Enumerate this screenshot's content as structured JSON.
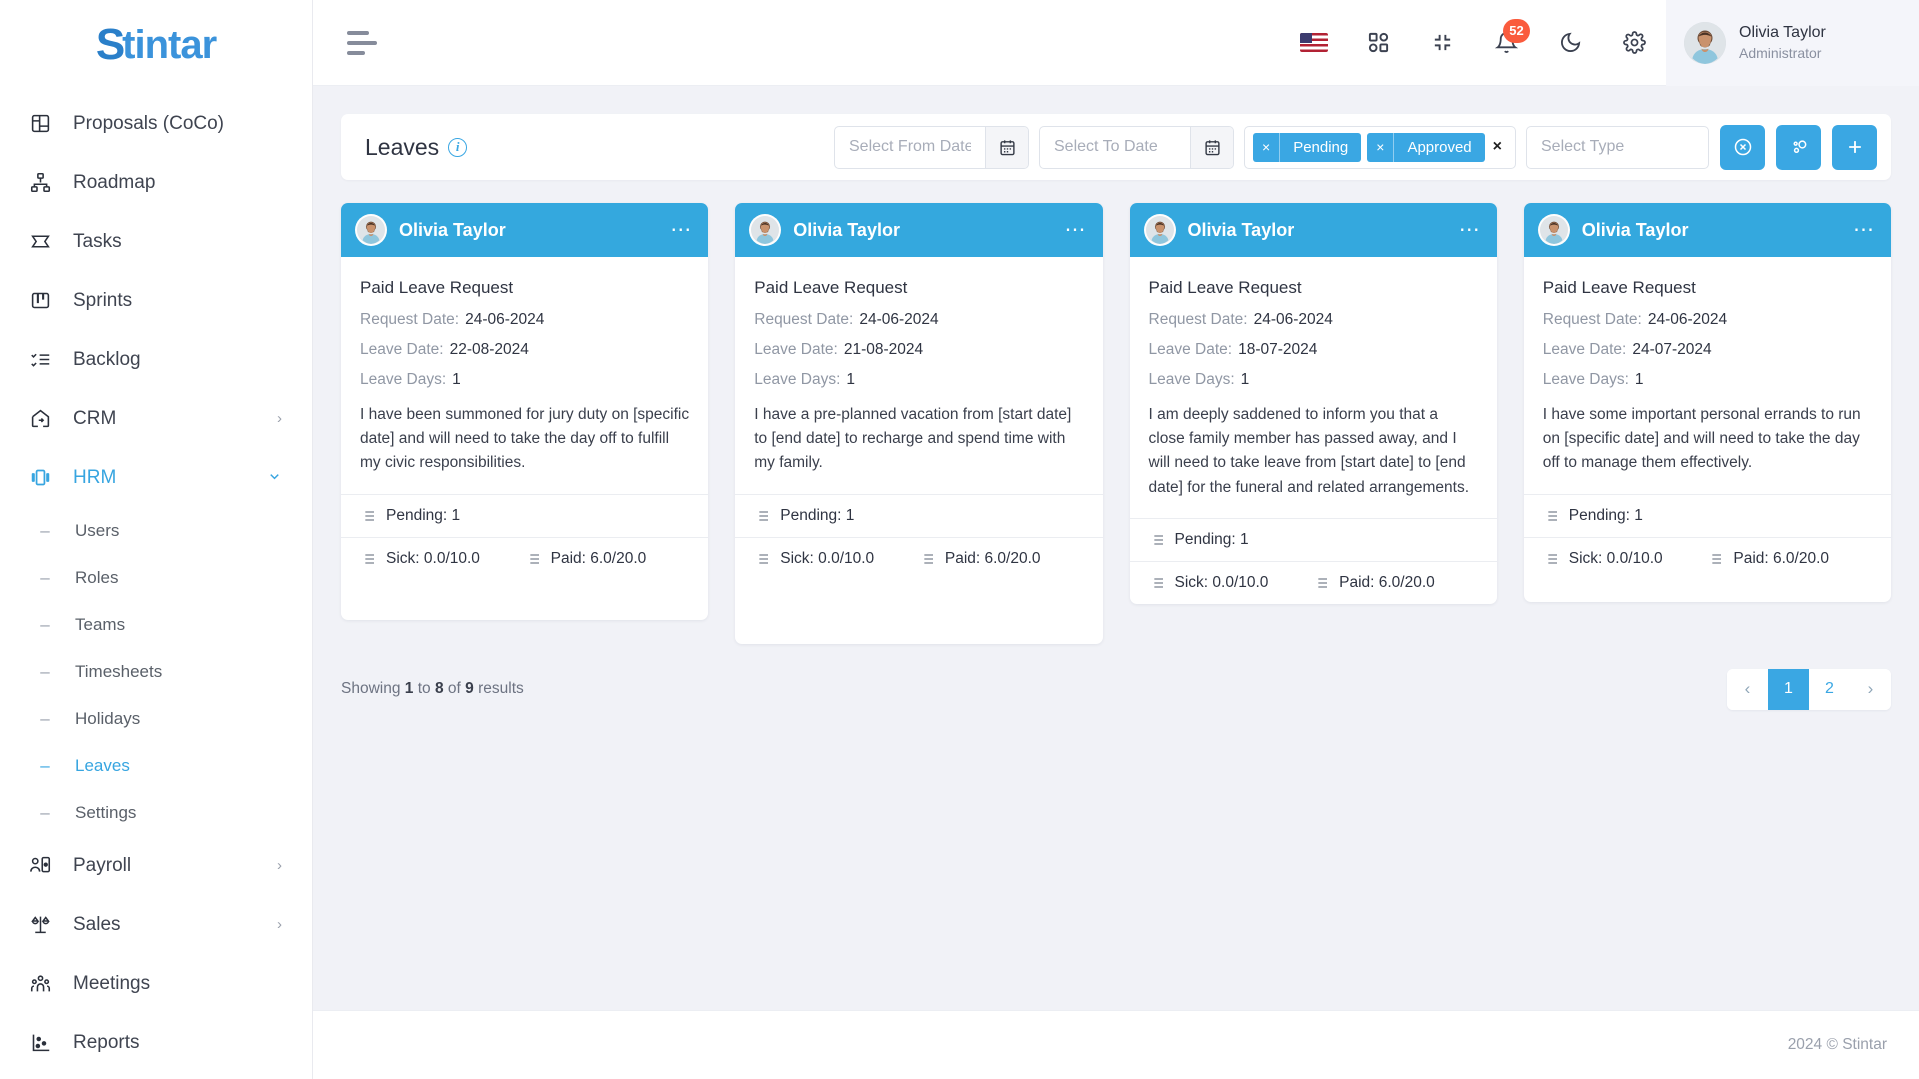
{
  "brand": {
    "first": "S",
    "rest": "tintar"
  },
  "sidebar": {
    "items": [
      {
        "label": "Proposals (CoCo)",
        "icon": "proposals-icon",
        "chevron": ""
      },
      {
        "label": "Roadmap",
        "icon": "roadmap-icon",
        "chevron": ""
      },
      {
        "label": "Tasks",
        "icon": "tasks-icon",
        "chevron": ""
      },
      {
        "label": "Sprints",
        "icon": "sprints-icon",
        "chevron": ""
      },
      {
        "label": "Backlog",
        "icon": "backlog-icon",
        "chevron": ""
      },
      {
        "label": "CRM",
        "icon": "crm-icon",
        "chevron": "›"
      },
      {
        "label": "HRM",
        "icon": "hrm-icon",
        "chevron": "⌄"
      }
    ],
    "hrm_children": [
      {
        "label": "Users"
      },
      {
        "label": "Roles"
      },
      {
        "label": "Teams"
      },
      {
        "label": "Timesheets"
      },
      {
        "label": "Holidays"
      },
      {
        "label": "Leaves"
      },
      {
        "label": "Settings"
      }
    ],
    "tail_items": [
      {
        "label": "Payroll",
        "icon": "payroll-icon",
        "chevron": "›"
      },
      {
        "label": "Sales",
        "icon": "sales-icon",
        "chevron": "›"
      },
      {
        "label": "Meetings",
        "icon": "meetings-icon",
        "chevron": ""
      },
      {
        "label": "Reports",
        "icon": "reports-icon",
        "chevron": ""
      }
    ]
  },
  "topbar": {
    "menu_toggle": "hamburger-icon",
    "language_flag": "us-flag-icon",
    "apps": "grid-apps-icon",
    "fullscreen": "collapse-fullscreen-icon",
    "notifications_icon": "bell-icon",
    "notifications_count": "52",
    "theme": "moon-dark-mode-icon",
    "settings": "gear-icon",
    "user_name": "Olivia Taylor",
    "user_role": "Administrator"
  },
  "filters": {
    "title": "Leaves",
    "info": "i",
    "from_date_placeholder": "Select From Date",
    "from_date_value": "",
    "to_date_placeholder": "Select To Date",
    "to_date_value": "",
    "status_tags": [
      "Pending",
      "Approved"
    ],
    "tag_remove": "×",
    "clear_all": "×",
    "type_placeholder": "Select Type",
    "buttons": [
      {
        "name": "reset-filters-button",
        "icon": "circle-x-icon"
      },
      {
        "name": "advanced-filter-button",
        "icon": "filter-nodes-icon"
      },
      {
        "name": "add-leave-button",
        "icon": "plus-icon"
      }
    ]
  },
  "cards": [
    {
      "name": "Olivia Taylor",
      "type": "Paid Leave Request",
      "request_date_label": "Request Date:",
      "request_date": "24-06-2024",
      "leave_date_label": "Leave Date:",
      "leave_date": "22-08-2024",
      "leave_days_label": "Leave Days:",
      "leave_days": "1",
      "description": "I have been summoned for jury duty on [specific date] and will need to take the day off to fulfill my civic responsibilities.",
      "pending": "Pending: 1",
      "sick": "Sick: 0.0/10.0",
      "paid": "Paid: 6.0/20.0"
    },
    {
      "name": "Olivia Taylor",
      "type": "Paid Leave Request",
      "request_date_label": "Request Date:",
      "request_date": "24-06-2024",
      "leave_date_label": "Leave Date:",
      "leave_date": "21-08-2024",
      "leave_days_label": "Leave Days:",
      "leave_days": "1",
      "description": "I have a pre-planned vacation from [start date] to [end date] to recharge and spend time with my family.",
      "pending": "Pending: 1",
      "sick": "Sick: 0.0/10.0",
      "paid": "Paid: 6.0/20.0"
    },
    {
      "name": "Olivia Taylor",
      "type": "Paid Leave Request",
      "request_date_label": "Request Date:",
      "request_date": "24-06-2024",
      "leave_date_label": "Leave Date:",
      "leave_date": "18-07-2024",
      "leave_days_label": "Leave Days:",
      "leave_days": "1",
      "description": "I am deeply saddened to inform you that a close family member has passed away, and I will need to take leave from [start date] to [end date] for the funeral and related arrangements.",
      "pending": "Pending: 1",
      "sick": "Sick: 0.0/10.0",
      "paid": "Paid: 6.0/20.0"
    },
    {
      "name": "Olivia Taylor",
      "type": "Paid Leave Request",
      "request_date_label": "Request Date:",
      "request_date": "24-06-2024",
      "leave_date_label": "Leave Date:",
      "leave_date": "24-07-2024",
      "leave_days_label": "Leave Days:",
      "leave_days": "1",
      "description": "I have some important personal errands to run on [specific date] and will need to take the day off to manage them effectively.",
      "pending": "Pending: 1",
      "sick": "Sick: 0.0/10.0",
      "paid": "Paid: 6.0/20.0"
    }
  ],
  "pagination": {
    "showing_prefix": "Showing",
    "from": "1",
    "to_word": "to",
    "to": "8",
    "of_word": "of",
    "total": "9",
    "results_word": "results",
    "prev": "‹",
    "pages": [
      "1",
      "2"
    ],
    "next": "›"
  },
  "footer": {
    "copyright": "2024 © Stintar"
  },
  "colors": {
    "accent": "#3aa7e3",
    "card_header": "#34a8de",
    "badge": "#fa5b3d",
    "page_bg": "#f1f2f7"
  }
}
